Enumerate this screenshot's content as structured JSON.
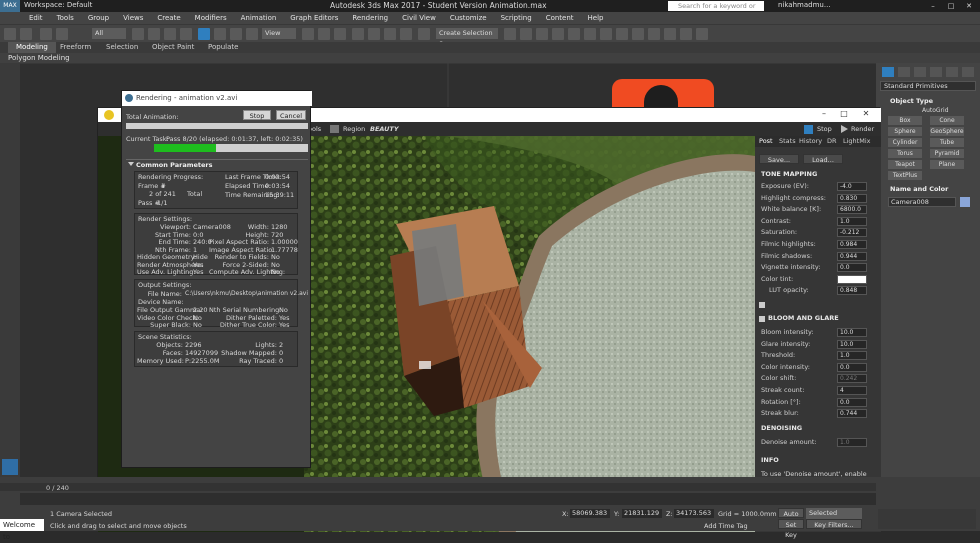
{
  "titlebar": {
    "workspace": "Workspace: Default",
    "title": "Autodesk 3ds Max 2017 - Student Version   Animation.max",
    "search_placeholder": "Search for a keyword or phrase",
    "user": "nikahmadmu...",
    "app_badge": "MAX"
  },
  "menubar": [
    "Edit",
    "Tools",
    "Group",
    "Views",
    "Create",
    "Modifiers",
    "Animation",
    "Graph Editors",
    "Rendering",
    "Civil View",
    "Customize",
    "Scripting",
    "Content",
    "Help"
  ],
  "toolbar": {
    "filter": "All",
    "ref_coord": "View",
    "selection_set": "Create Selection Se"
  },
  "ribbon": {
    "tabs": [
      "Modeling",
      "Freeform",
      "Selection",
      "Object Paint",
      "Populate"
    ],
    "active": "Modeling",
    "subbar": "Polygon Modeling"
  },
  "render_frame": {
    "toolbar_tools": "ools",
    "region": "Region",
    "channel": "BEAUTY",
    "stop": "Stop",
    "render": "Render",
    "panel_tabs": [
      "Post",
      "Stats",
      "History",
      "DR",
      "LightMix"
    ],
    "save": "Save...",
    "load": "Load...",
    "tone_mapping": {
      "heading": "TONE MAPPING",
      "rows": [
        {
          "label": "Exposure (EV):",
          "value": "-4.0"
        },
        {
          "label": "Highlight compress:",
          "value": "0.830"
        },
        {
          "label": "White balance [K]:",
          "value": "6800.0"
        },
        {
          "label": "Contrast:",
          "value": "1.0"
        },
        {
          "label": "Saturation:",
          "value": "-0.212"
        },
        {
          "label": "Filmic highlights:",
          "value": "0.984"
        },
        {
          "label": "Filmic shadows:",
          "value": "0.944"
        },
        {
          "label": "Vignette intensity:",
          "value": "0.0"
        },
        {
          "label": "Color tint:",
          "value": ""
        },
        {
          "label": "LUT opacity:",
          "value": "0.848"
        }
      ]
    },
    "bloom": {
      "heading": "BLOOM AND GLARE",
      "rows": [
        {
          "label": "Bloom intensity:",
          "value": "10.0"
        },
        {
          "label": "Glare intensity:",
          "value": "10.0"
        },
        {
          "label": "Threshold:",
          "value": "1.0"
        },
        {
          "label": "Color intensity:",
          "value": "0.0"
        },
        {
          "label": "Color shift:",
          "value": "0.242"
        },
        {
          "label": "Streak count:",
          "value": "4"
        },
        {
          "label": "Rotation [°]:",
          "value": "0.0"
        },
        {
          "label": "Streak blur:",
          "value": "0.744"
        }
      ]
    },
    "denoising": {
      "heading": "DENOISING",
      "label": "Denoise amount:",
      "value": "1.0"
    },
    "info": {
      "heading": "INFO",
      "text": "To use 'Denoise amount', enable denoising in Scene render tab."
    }
  },
  "rendering_dialog": {
    "title": "Rendering - animation v2.avi",
    "total_animation": "Total Animation:",
    "stop": "Stop",
    "cancel": "Cancel",
    "current_task": "Current Task:",
    "task_value": "Pass 8/20 (elapsed: 0:01:37, left: 0:02:35)",
    "task_progress": 0.4,
    "common_parameters": "Common Parameters",
    "progress": {
      "heading": "Rendering Progress:",
      "frame_label": "Frame #",
      "frame_value": "1",
      "of_line": "2 of 241",
      "total": "Total",
      "pass_label": "Pass #",
      "pass_value": "1/1",
      "last_frame_label": "Last Frame Time:",
      "last_frame_value": "0:03:54",
      "elapsed_label": "Elapsed Time:",
      "elapsed_value": "0:03:54",
      "remaining_label": "Time Remaining:",
      "remaining_value": "15:39:11"
    },
    "render_settings": {
      "heading": "Render Settings:",
      "left": [
        {
          "label": "Viewport:",
          "value": "Camera008"
        },
        {
          "label": "Start Time:",
          "value": "0:0"
        },
        {
          "label": "End Time:",
          "value": "240:0"
        },
        {
          "label": "Nth Frame:",
          "value": "1"
        },
        {
          "label": "Hidden Geometry:",
          "value": "Hide"
        },
        {
          "label": "Render Atmosphere:",
          "value": "Yes"
        },
        {
          "label": "Use Adv. Lighting:",
          "value": "Yes"
        }
      ],
      "right": [
        {
          "label": "Width:",
          "value": "1280"
        },
        {
          "label": "Height:",
          "value": "720"
        },
        {
          "label": "Pixel Aspect Ratio:",
          "value": "1.00000"
        },
        {
          "label": "Image Aspect Ratio:",
          "value": "1.77778"
        },
        {
          "label": "Render to Fields:",
          "value": "No"
        },
        {
          "label": "Force 2-Sided:",
          "value": "No"
        },
        {
          "label": "Compute Adv. Lighting:",
          "value": "No"
        }
      ]
    },
    "output_settings": {
      "heading": "Output Settings:",
      "file_label": "File Name:",
      "file_value": "C:\\Users\\nkmu\\Desktop\\animation v2.avi",
      "device_label": "Device Name:",
      "left": [
        {
          "label": "File Output Gamma:",
          "value": "2.20"
        },
        {
          "label": "Video Color Check:",
          "value": "No"
        },
        {
          "label": "Super Black:",
          "value": "No"
        }
      ],
      "right": [
        {
          "label": "Nth Serial Numbering:",
          "value": "No"
        },
        {
          "label": "Dither Paletted:",
          "value": "Yes"
        },
        {
          "label": "Dither True Color:",
          "value": "Yes"
        }
      ]
    },
    "scene_statistics": {
      "heading": "Scene Statistics:",
      "left": [
        {
          "label": "Objects:",
          "value": "2296"
        },
        {
          "label": "Faces:",
          "value": "14927099"
        },
        {
          "label": "Memory Used:",
          "value": "P:2255.0M"
        }
      ],
      "right": [
        {
          "label": "Lights:",
          "value": "2"
        },
        {
          "label": "Shadow Mapped:",
          "value": "0"
        },
        {
          "label": "Ray Traced:",
          "value": "0"
        }
      ]
    }
  },
  "command_panel": {
    "category": "Standard Primitives",
    "autogrid": "AutoGrid",
    "object_type": "Object Type",
    "buttons": [
      "Box",
      "Cone",
      "Sphere",
      "GeoSphere",
      "Cylinder",
      "Tube",
      "Torus",
      "Pyramid",
      "Teapot",
      "Plane",
      "TextPlus"
    ],
    "name_color": "Name and Color",
    "object_name": "Camera008"
  },
  "status": {
    "frame_range": "0 / 240",
    "welcome": "Welcome to",
    "selection": "1 Camera Selected",
    "hint": "Click and drag to select and move objects",
    "x": "58069.383",
    "y": "21831.129",
    "z": "34173.563",
    "grid": "Grid = 1000.0mm",
    "add_time_tag": "Add Time Tag",
    "auto_key": "Auto Key",
    "selected": "Selected",
    "set_key": "Set Key",
    "key_filters": "Key Filters...",
    "x_label": "X:",
    "y_label": "Y:",
    "z_label": "Z:"
  },
  "colors": {
    "accent": "#3c6e91",
    "progress": "#1ebd1e",
    "grass": "#3a5a1e",
    "dirt": "#8a7660"
  }
}
